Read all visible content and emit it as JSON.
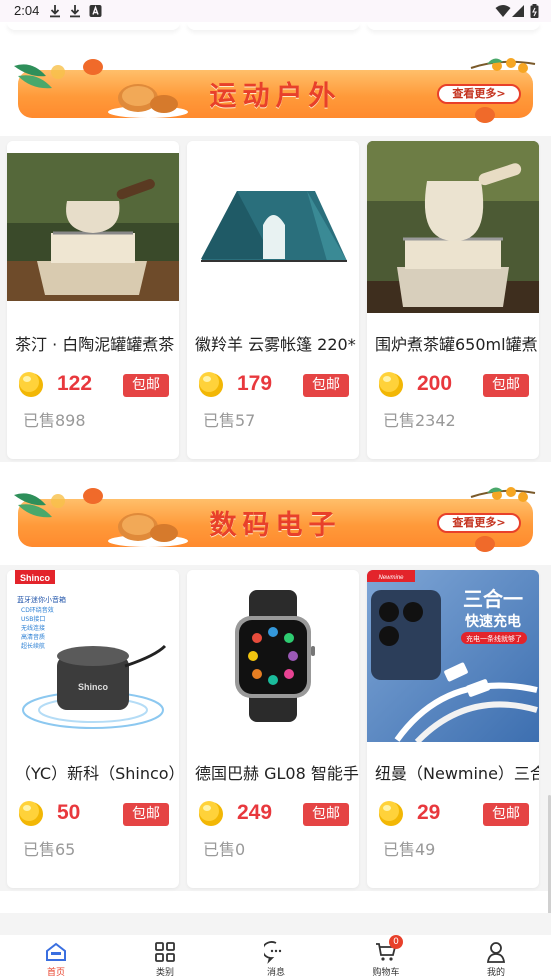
{
  "status_bar": {
    "time": "2:04"
  },
  "sections": [
    {
      "title": "运动户外",
      "more_label": "查看更多>",
      "products": [
        {
          "name": "茶汀 · 白陶泥罐罐煮茶",
          "price": "122",
          "badge": "包邮",
          "sold": "已售898"
        },
        {
          "name": "徽羚羊 云雾帐篷 220*",
          "price": "179",
          "badge": "包邮",
          "sold": "已售57"
        },
        {
          "name": "围炉煮茶罐650ml罐煮",
          "price": "200",
          "badge": "包邮",
          "sold": "已售2342"
        }
      ]
    },
    {
      "title": "数码电子",
      "more_label": "查看更多>",
      "products": [
        {
          "name": "（YC）新科（Shinco）",
          "price": "50",
          "badge": "包邮",
          "sold": "已售65",
          "brand": "Shinco",
          "img_lines": [
            "蓝牙迷你小音箱",
            "CD环绕音效",
            "USB接口",
            "无线连接",
            "高清音质",
            "超长续航"
          ]
        },
        {
          "name": "德国巴赫 GL08 智能手",
          "price": "249",
          "badge": "包邮",
          "sold": "已售0"
        },
        {
          "name": "纽曼（Newmine）三合",
          "price": "29",
          "badge": "包邮",
          "sold": "已售49",
          "brand": "Newmine",
          "img_title": "三合一",
          "img_sub": "快速充电",
          "img_note": "充电一条线就够了"
        }
      ]
    }
  ],
  "tabbar": {
    "items": [
      {
        "label": "首页",
        "icon": "home-icon",
        "active": true
      },
      {
        "label": "类别",
        "icon": "category-grid-icon"
      },
      {
        "label": "消息",
        "icon": "chat-bubble-icon"
      },
      {
        "label": "购物车",
        "icon": "cart-icon",
        "count": "0"
      },
      {
        "label": "我的",
        "icon": "person-icon"
      }
    ]
  },
  "colors": {
    "accent": "#e8402a",
    "price": "#e8383d",
    "badge_bg": "#e54444",
    "banner_orange": "#ff9a3a"
  }
}
